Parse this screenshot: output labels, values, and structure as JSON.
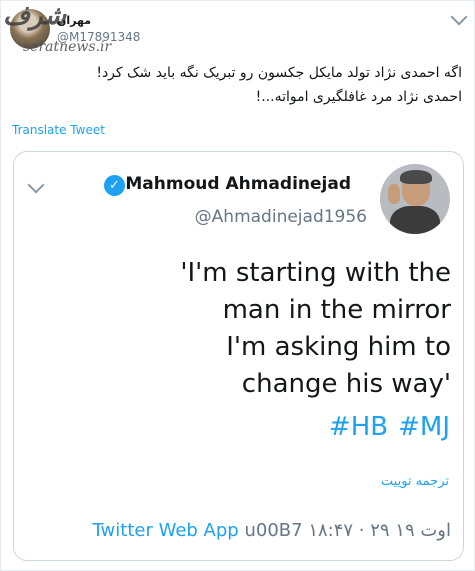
{
  "outer_tweet": {
    "display_name": "مهران",
    "handle": "@M17891348",
    "text_line1": "اگه احمدی نژاد تولد مایکل جکسون رو تبریک نگه باید شک کرد!",
    "text_line2": "احمدی نژاد مرد غافلگیری امواته...!",
    "translate_label": "Translate Tweet",
    "watermark_logo": "شرف",
    "watermark_text": "seratnews.ir"
  },
  "quoted_tweet": {
    "display_name": "Mahmoud Ahmadinejad",
    "verified_icon": "✓",
    "handle": "@Ahmadinejad1956",
    "text_lines": [
      "'I'm starting with the",
      "man in the mirror",
      "I'm asking him to",
      "change his way'"
    ],
    "hashtags": [
      "#HB",
      "#MJ"
    ],
    "translate_label": "ترجمه توییت",
    "time": "۱۸:۴۷ · ۲۹ اوت ۱۹",
    "separator": "u00B7",
    "source": "Twitter Web App"
  },
  "icons": {
    "outer_menu": "chevron-down-icon",
    "inner_menu": "chevron-down-icon",
    "verified": "verified-badge-icon"
  },
  "colors": {
    "link_blue": "#1da1f2",
    "muted_gray": "#657786",
    "text": "#14171a",
    "border": "#ccd6dd"
  }
}
